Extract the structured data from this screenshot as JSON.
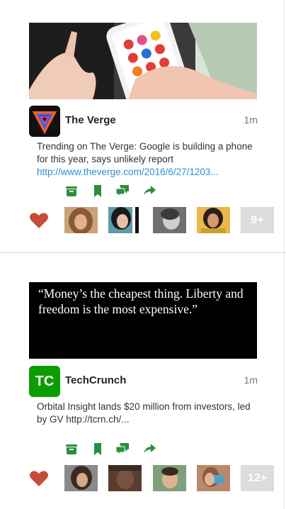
{
  "colors": {
    "accent": "#2b8f3a",
    "heart": "#c44d3a",
    "link": "#2a8fd8"
  },
  "cards": [
    {
      "source": "The Verge",
      "time": "1m",
      "text": "Trending on The Verge: Google is building a phone for this year, says unlikely report",
      "link": "http://www.theverge.com/2016/6/27/1203...",
      "more_count": "9+",
      "icons": [
        "inbox-icon",
        "bookmark-icon",
        "comment-icon",
        "share-icon"
      ]
    },
    {
      "source": "TechCrunch",
      "logo_text": "TC",
      "time": "1m",
      "quote": "“Money’s the cheapest thing. Liberty and freedom is the most expensive.”",
      "text": "Orbital Insight lands $20 million from investors, led by GV http://tcrn.ch/...",
      "more_count": "12+",
      "icons": [
        "inbox-icon",
        "bookmark-icon",
        "comment-icon",
        "share-icon"
      ]
    }
  ]
}
